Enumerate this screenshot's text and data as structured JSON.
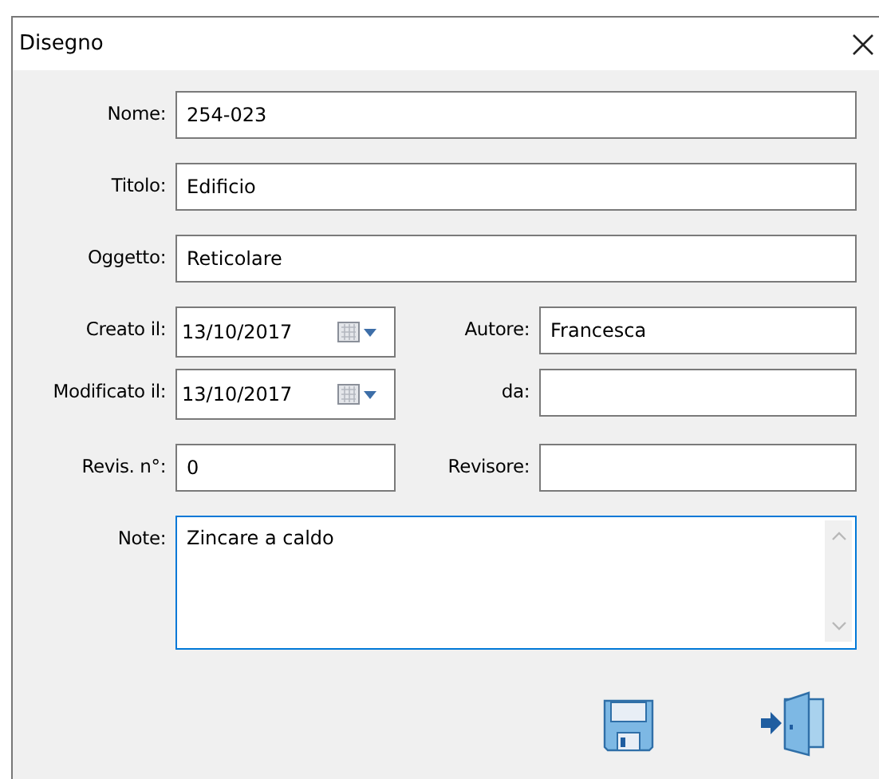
{
  "window": {
    "title": "Disegno"
  },
  "rows": [
    {
      "kind": "single",
      "field": {
        "label": "Nome:",
        "value": "254-023",
        "kind": "text"
      }
    },
    {
      "kind": "single",
      "field": {
        "label": "Titolo:",
        "value": "Edificio",
        "kind": "text"
      }
    },
    {
      "kind": "single",
      "field": {
        "label": "Oggetto:",
        "value": "Reticolare",
        "kind": "text"
      }
    },
    {
      "kind": "pair",
      "left": {
        "label": "Creato il:",
        "value": "13/10/2017",
        "kind": "date"
      },
      "right": {
        "label": "Autore:",
        "value": "Francesca",
        "kind": "text"
      }
    },
    {
      "kind": "pair",
      "left": {
        "label": "Modificato il:",
        "value": "13/10/2017",
        "kind": "date"
      },
      "right": {
        "label": "da:",
        "kind": "text"
      }
    },
    {
      "kind": "pair",
      "left": {
        "label": "Revis. n°:",
        "value": "0",
        "kind": "text"
      },
      "right": {
        "label": "Revisore:",
        "kind": "text"
      }
    },
    {
      "kind": "single",
      "field": {
        "label": "Note:",
        "value": "Zincare a caldo",
        "kind": "memo",
        "focused": true
      }
    }
  ],
  "buttons": [
    {
      "kind": "save"
    },
    {
      "kind": "exit"
    }
  ]
}
